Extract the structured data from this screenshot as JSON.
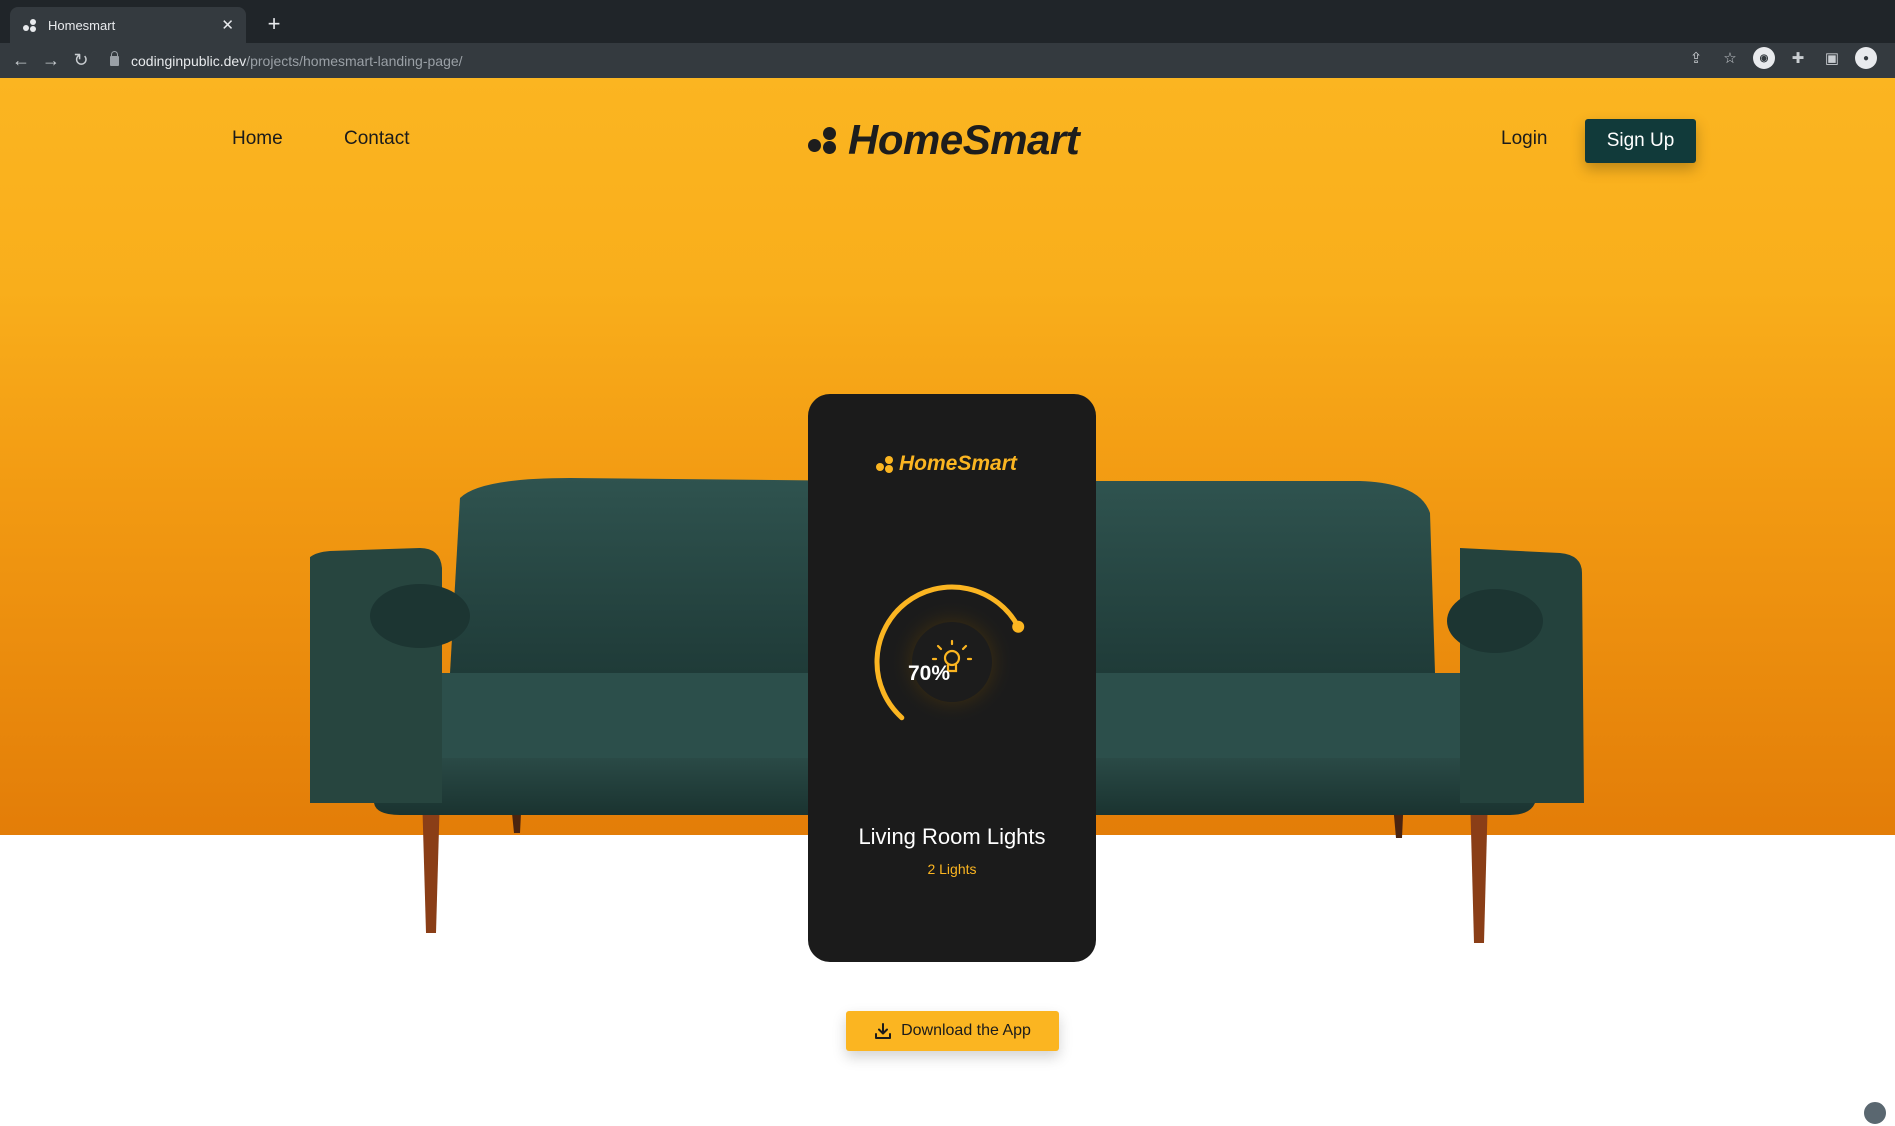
{
  "browser": {
    "tab_title": "Homesmart",
    "tab_close": "✕",
    "new_tab": "+",
    "url_domain": "codinginpublic.dev",
    "url_path": "/projects/homesmart-landing-page/"
  },
  "nav": {
    "home": "Home",
    "contact": "Contact",
    "brand": "HomeSmart",
    "login": "Login",
    "signup": "Sign Up"
  },
  "phone": {
    "brand": "HomeSmart",
    "percent": "70%",
    "level": 0.7,
    "room": "Living Room Lights",
    "count": "2 Lights"
  },
  "cta": {
    "download": "Download the App"
  },
  "colors": {
    "accent": "#fbb521",
    "dark_teal": "#113a3a",
    "phone_bg": "#1b1b1b"
  }
}
